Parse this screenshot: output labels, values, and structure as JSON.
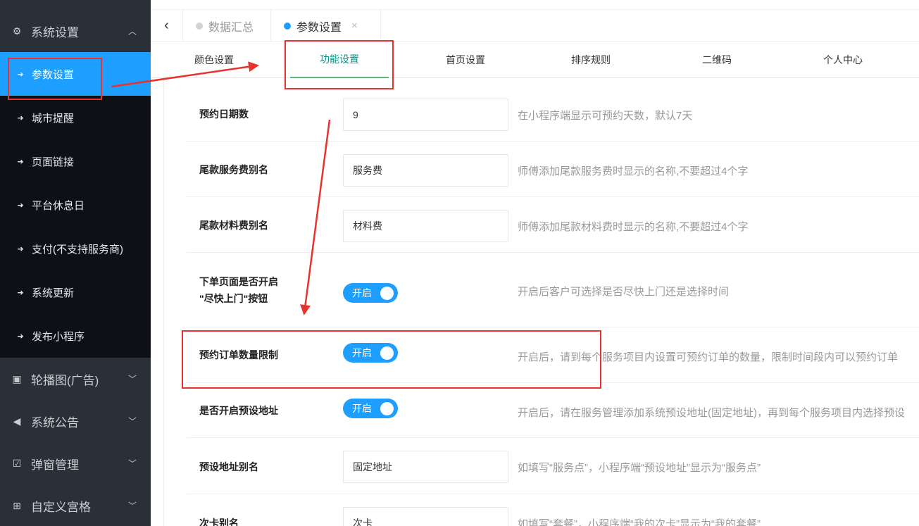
{
  "sidebar": {
    "system_group": {
      "label": "系统设置",
      "icon": "gear-icon"
    },
    "sub_items": [
      {
        "label": "参数设置",
        "active": true
      },
      {
        "label": "城市提醒"
      },
      {
        "label": "页面链接"
      },
      {
        "label": "平台休息日"
      },
      {
        "label": "支付(不支持服务商)"
      },
      {
        "label": "系统更新"
      },
      {
        "label": "发布小程序"
      }
    ],
    "groups": [
      {
        "label": "轮播图(广告)",
        "icon": "image-icon"
      },
      {
        "label": "系统公告",
        "icon": "speaker-icon"
      },
      {
        "label": "弹窗管理",
        "icon": "checkbox-icon"
      },
      {
        "label": "自定义宫格",
        "icon": "sitemap-icon"
      }
    ]
  },
  "topbar": {
    "tabs": [
      {
        "label": "数据汇总"
      },
      {
        "label": "参数设置",
        "close": "×"
      }
    ]
  },
  "subtabs": [
    "颜色设置",
    "功能设置",
    "首页设置",
    "排序规则",
    "二维码",
    "个人中心"
  ],
  "form": {
    "booking_days": {
      "label": "预约日期数",
      "value": "9",
      "hint": "在小程序端显示可预约天数，默认7天"
    },
    "service_fee_alias": {
      "label": "尾款服务费别名",
      "value": "服务费",
      "hint": "师傅添加尾款服务费时显示的名称,不要超过4个字"
    },
    "material_fee_alias": {
      "label": "尾款材料费别名",
      "value": "材料费",
      "hint": "师傅添加尾款材料费时显示的名称,不要超过4个字"
    },
    "asap_button": {
      "label_line1": "下单页面是否开启",
      "label_line2": "\"尽快上门\"按钮",
      "switch_text": "开启",
      "hint": "开启后客户可选择是否尽快上门还是选择时间"
    },
    "order_limit": {
      "label": "预约订单数量限制",
      "switch_text": "开启",
      "hint": "开启后，请到每个服务项目内设置可预约订单的数量，限制时间段内可以预约订单"
    },
    "preset_address": {
      "label": "是否开启预设地址",
      "switch_text": "开启",
      "hint": "开启后，请在服务管理添加系统预设地址(固定地址)，再到每个服务项目内选择预设"
    },
    "preset_address_alias": {
      "label": "预设地址别名",
      "value": "固定地址",
      "hint": "如填写“服务点”，小程序端“预设地址”显示为“服务点”"
    },
    "card_alias": {
      "label": "次卡别名",
      "value": "次卡",
      "hint": "如填写“套餐”，小程序端“我的次卡”显示为“我的套餐”"
    }
  },
  "colors": {
    "accent": "#1e9fff",
    "sidebar": "#2b3038",
    "annotation": "#e8322e",
    "active_subtab": "#009688"
  }
}
